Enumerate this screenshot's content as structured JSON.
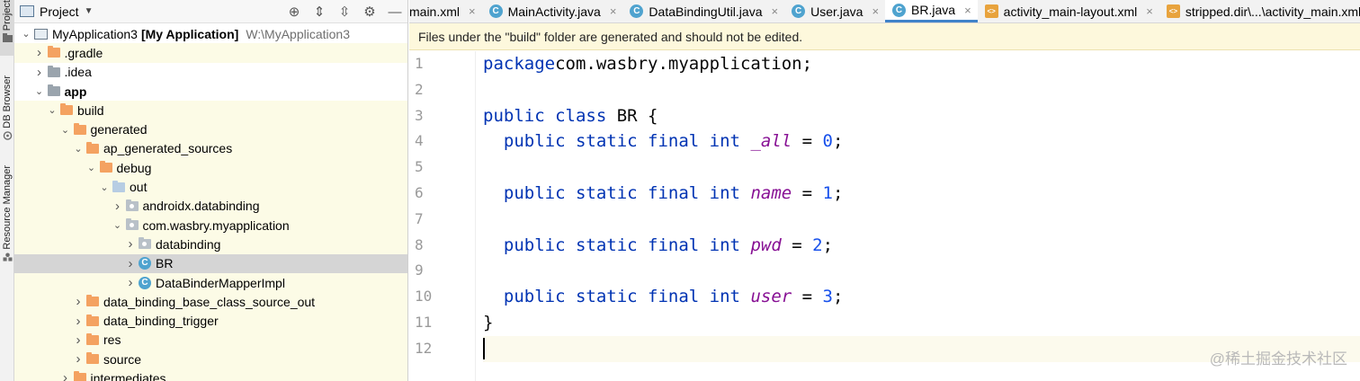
{
  "toolstrip": {
    "project": "Project",
    "db_browser": "DB Browser",
    "resource_manager": "Resource Manager"
  },
  "project_panel": {
    "title": "Project",
    "rows": [
      {
        "depth": 0,
        "arrow": "down",
        "icon": "module",
        "label": "MyApplication3",
        "bold_suffix": "[My Application]",
        "suffix": "W:\\MyApplication3",
        "hl": false
      },
      {
        "depth": 1,
        "arrow": "right",
        "icon": "folder",
        "label": ".gradle",
        "hl": true
      },
      {
        "depth": 1,
        "arrow": "right",
        "icon": "folder-grey",
        "label": ".idea",
        "hl": false
      },
      {
        "depth": 1,
        "arrow": "down",
        "icon": "folder-grey",
        "label": "app",
        "bold": true,
        "hl": false
      },
      {
        "depth": 2,
        "arrow": "down",
        "icon": "folder",
        "label": "build",
        "hl": true
      },
      {
        "depth": 3,
        "arrow": "down",
        "icon": "folder",
        "label": "generated",
        "hl": true
      },
      {
        "depth": 4,
        "arrow": "down",
        "icon": "folder",
        "label": "ap_generated_sources",
        "hl": true
      },
      {
        "depth": 5,
        "arrow": "down",
        "icon": "folder",
        "label": "debug",
        "hl": true
      },
      {
        "depth": 6,
        "arrow": "down",
        "icon": "folder-out",
        "label": "out",
        "hl": true
      },
      {
        "depth": 7,
        "arrow": "right",
        "icon": "package",
        "label": "androidx.databinding",
        "hl": true
      },
      {
        "depth": 7,
        "arrow": "down",
        "icon": "package",
        "label": "com.wasbry.myapplication",
        "hl": true
      },
      {
        "depth": 8,
        "arrow": "right",
        "icon": "package",
        "label": "databinding",
        "hl": true
      },
      {
        "depth": 8,
        "arrow": "right",
        "icon": "class",
        "label": "BR",
        "hl": false,
        "sel": true
      },
      {
        "depth": 8,
        "arrow": "right",
        "icon": "class",
        "label": "DataBinderMapperImpl",
        "hl": true
      },
      {
        "depth": 4,
        "arrow": "right",
        "icon": "folder",
        "label": "data_binding_base_class_source_out",
        "hl": true
      },
      {
        "depth": 4,
        "arrow": "right",
        "icon": "folder",
        "label": "data_binding_trigger",
        "hl": true
      },
      {
        "depth": 4,
        "arrow": "right",
        "icon": "folder",
        "label": "res",
        "hl": true
      },
      {
        "depth": 4,
        "arrow": "right",
        "icon": "folder",
        "label": "source",
        "hl": true
      },
      {
        "depth": 3,
        "arrow": "right",
        "icon": "folder",
        "label": "intermediates",
        "hl": true
      }
    ]
  },
  "tabs": [
    {
      "label": "main.xml",
      "icon": "xml",
      "active": false,
      "partial": true
    },
    {
      "label": "MainActivity.java",
      "icon": "class",
      "active": false
    },
    {
      "label": "DataBindingUtil.java",
      "icon": "class",
      "active": false
    },
    {
      "label": "User.java",
      "icon": "class",
      "active": false
    },
    {
      "label": "BR.java",
      "icon": "class",
      "active": true
    },
    {
      "label": "activity_main-layout.xml",
      "icon": "xml",
      "active": false
    },
    {
      "label": "stripped.dir\\...\\activity_main.xml",
      "icon": "xml",
      "active": false
    }
  ],
  "banner": "Files under the \"build\" folder are generated and should not be edited.",
  "code_lines": [
    {
      "n": "1",
      "tokens": [
        [
          "kw",
          "package"
        ],
        [
          "",
          "com.wasbry.myapplication;"
        ]
      ]
    },
    {
      "n": "2",
      "tokens": []
    },
    {
      "n": "3",
      "tokens": [
        [
          "kw",
          "public class"
        ],
        [
          "",
          " BR {"
        ]
      ]
    },
    {
      "n": "4",
      "tokens": [
        [
          "",
          "  "
        ],
        [
          "kw",
          "public static final int"
        ],
        [
          "",
          " "
        ],
        [
          "fld",
          "_all"
        ],
        [
          "",
          " = "
        ],
        [
          "num",
          "0"
        ],
        [
          "",
          ";"
        ]
      ]
    },
    {
      "n": "5",
      "tokens": []
    },
    {
      "n": "6",
      "tokens": [
        [
          "",
          "  "
        ],
        [
          "kw",
          "public static final int"
        ],
        [
          "",
          " "
        ],
        [
          "fld",
          "name"
        ],
        [
          "",
          " = "
        ],
        [
          "num",
          "1"
        ],
        [
          "",
          ";"
        ]
      ]
    },
    {
      "n": "7",
      "tokens": []
    },
    {
      "n": "8",
      "tokens": [
        [
          "",
          "  "
        ],
        [
          "kw",
          "public static final int"
        ],
        [
          "",
          " "
        ],
        [
          "fld",
          "pwd"
        ],
        [
          "",
          " = "
        ],
        [
          "num",
          "2"
        ],
        [
          "",
          ";"
        ]
      ]
    },
    {
      "n": "9",
      "tokens": []
    },
    {
      "n": "10",
      "tokens": [
        [
          "",
          "  "
        ],
        [
          "kw",
          "public static final int"
        ],
        [
          "",
          " "
        ],
        [
          "fld",
          "user"
        ],
        [
          "",
          " = "
        ],
        [
          "num",
          "3"
        ],
        [
          "",
          ";"
        ]
      ]
    },
    {
      "n": "11",
      "tokens": [
        [
          "",
          "}"
        ]
      ]
    },
    {
      "n": "12",
      "tokens": [],
      "current": true
    }
  ],
  "watermark": "@稀土掘金技术社区"
}
